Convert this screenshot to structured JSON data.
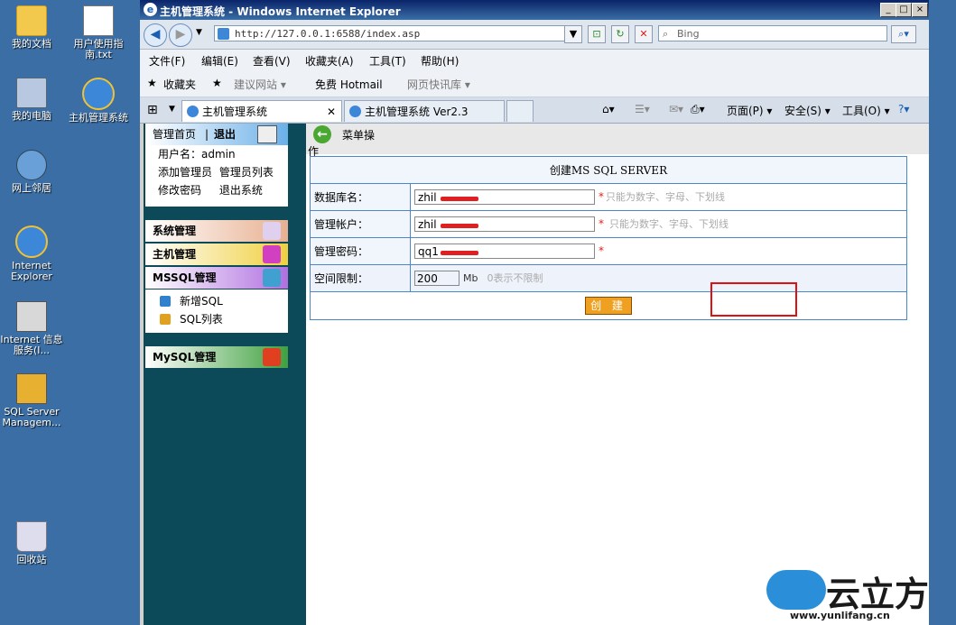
{
  "desktop": {
    "icons": [
      {
        "label": "我的文档"
      },
      {
        "label": "用户使用指南.txt"
      },
      {
        "label": "我的电脑"
      },
      {
        "label": "主机管理系统"
      },
      {
        "label": "网上邻居"
      },
      {
        "label": "Internet Explorer"
      },
      {
        "label": "Internet 信息服务(I..."
      },
      {
        "label": "SQL Server Managem..."
      },
      {
        "label": "回收站"
      }
    ]
  },
  "window": {
    "title": "主机管理系统 - Windows Internet Explorer",
    "address": "http://127.0.0.1:6588/index.asp",
    "search_placeholder": "Bing",
    "menu": [
      "文件(F)",
      "编辑(E)",
      "查看(V)",
      "收藏夹(A)",
      "工具(T)",
      "帮助(H)"
    ],
    "favorites": {
      "fav_label": "收藏夹",
      "items": [
        "建议网站 ▾",
        "免费 Hotmail",
        "网页快讯库 ▾"
      ]
    },
    "tabs": [
      {
        "label": "主机管理系统"
      },
      {
        "label": "主机管理系统 Ver2.3"
      }
    ],
    "commands": [
      "页面(P) ▾",
      "安全(S) ▾",
      "工具(O) ▾"
    ]
  },
  "sidebar": {
    "home": "管理首页",
    "logout": "退出",
    "username_label": "用户名：admin",
    "links": [
      "添加管理员",
      "管理员列表",
      "修改密码",
      "退出系统"
    ],
    "categories": [
      "系统管理",
      "主机管理",
      "MSSQL管理",
      "MySQL管理"
    ],
    "mssql_items": [
      "新增SQL",
      "SQL列表"
    ]
  },
  "main": {
    "crumb_line1": "菜单操",
    "crumb_line2": "作",
    "form": {
      "header": "创建MS SQL SERVER",
      "db_label": "数据库名：",
      "db_value": "zhil",
      "db_hint": "只能为数字、字母、下划线",
      "user_label": "管理帐户：",
      "user_value": "zhil",
      "user_hint": "只能为数字、字母、下划线",
      "pwd_label": "管理密码：",
      "pwd_value": "qq1",
      "space_label": "空间限制：",
      "space_value": "200",
      "space_unit": "Mb",
      "space_hint": "0表示不限制",
      "submit": "创 建",
      "required": "*"
    }
  },
  "watermark": {
    "brand": "云立方",
    "url": "www.yunlifang.cn"
  }
}
